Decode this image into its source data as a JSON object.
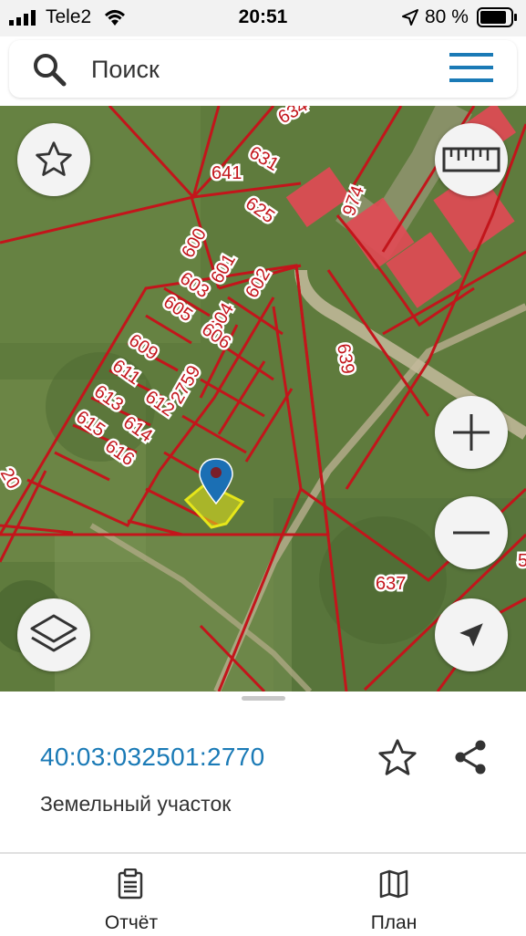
{
  "status_bar": {
    "carrier": "Tele2",
    "time": "20:51",
    "battery": "80 %"
  },
  "search": {
    "placeholder": "Поиск"
  },
  "map": {
    "parcel_labels": [
      "634",
      "631",
      "641",
      "625",
      "974",
      "600",
      "601",
      "603",
      "602",
      "605",
      "604",
      "606",
      "609",
      "611",
      "2759",
      "612",
      "613",
      "614",
      "615",
      "616",
      "639",
      "637",
      "20",
      "5"
    ],
    "buttons": [
      "favorites-star-icon",
      "ruler-icon",
      "zoom-in-icon",
      "zoom-out-icon",
      "layers-icon",
      "locate-arrow-icon"
    ]
  },
  "selected": {
    "cadastral_number": "40:03:032501:2770",
    "type": "Земельный участок"
  },
  "tabs": [
    {
      "label": "Отчёт",
      "icon": "clipboard-icon"
    },
    {
      "label": "План",
      "icon": "map-icon"
    }
  ],
  "colors": {
    "parcel_line": "#c3151b",
    "selected_parcel": "#e6e61a",
    "link": "#1a7ab6",
    "pin": "#1b6fb4"
  }
}
